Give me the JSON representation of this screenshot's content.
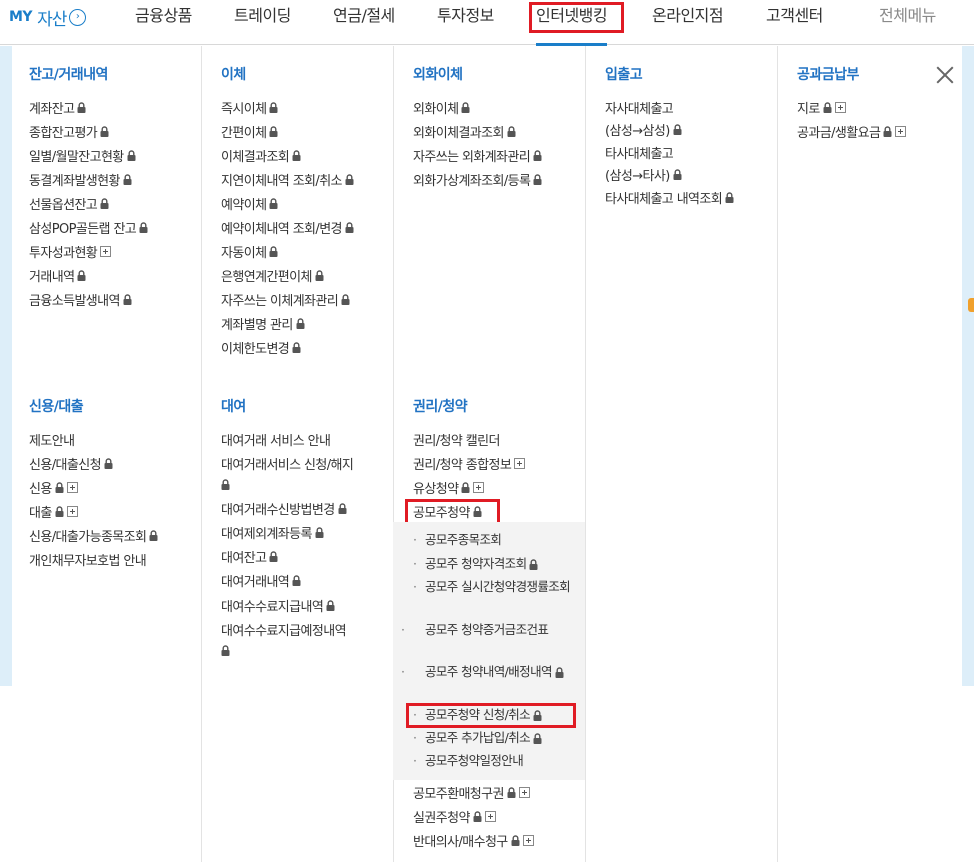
{
  "topnav": {
    "my_label": "MY",
    "asset_label": "자산",
    "items": [
      "금융상품",
      "트레이딩",
      "연금/절세",
      "투자정보",
      "인터넷뱅킹",
      "온라인지점",
      "고객센터",
      "전체메뉴"
    ]
  },
  "columns": {
    "balance": {
      "title": "잔고/거래내역",
      "items": [
        "계좌잔고",
        "종합잔고평가",
        "일별/월말잔고현황",
        "동결계좌발생현황",
        "선물옵션잔고",
        "삼성POP골든랩 잔고",
        "투자성과현황",
        "거래내역",
        "금융소득발생내역"
      ]
    },
    "transfer": {
      "title": "이체",
      "items": [
        "즉시이체",
        "간편이체",
        "이체결과조회",
        "지연이체내역 조회/취소",
        "예약이체",
        "예약이체내역 조회/변경",
        "자동이체",
        "은행연계간편이체",
        "자주쓰는 이체계좌관리",
        "계좌별명 관리",
        "이체한도변경"
      ]
    },
    "fx_transfer": {
      "title": "외화이체",
      "items": [
        "외화이체",
        "외화이체결과조회",
        "자주쓰는 외화계좌관리",
        "외화가상계좌조회/등록"
      ]
    },
    "in_out": {
      "title": "입출고",
      "items": [
        "자사대체출고",
        "(삼성→삼성)",
        "타사대체출고",
        "(삼성→타사)",
        "타사대체출고 내역조회"
      ]
    },
    "utility": {
      "title": "공과금납부",
      "items": [
        "지로",
        "공과금/생활요금"
      ]
    },
    "credit": {
      "title": "신용/대출",
      "items": [
        "제도안내",
        "신용/대출신청",
        "신용",
        "대출",
        "신용/대출가능종목조회",
        "개인채무자보호법 안내"
      ]
    },
    "lending": {
      "title": "대여",
      "items": [
        "대여거래 서비스 안내",
        "대여거래서비스 신청/해지",
        "대여거래수신방법변경",
        "대여제외계좌등록",
        "대여잔고",
        "대여거래내역",
        "대여수수료지급내역",
        "대여수수료지급예정내역"
      ]
    },
    "rights": {
      "title": "권리/청약",
      "items": [
        "권리/청약 캘린더",
        "권리/청약 종합정보",
        "유상청약",
        "공모주청약"
      ],
      "sub_items": [
        "공모주종목조회",
        "공모주 청약자격조회",
        "공모주 실시간청약경쟁률조회",
        "공모주 청약증거금조건표",
        "공모주 청약내역/배정내역",
        "공모주청약 신청/취소",
        "공모주 추가납입/취소",
        "공모주청약일정안내"
      ],
      "items_after": [
        "공모주환매청구권",
        "실권주청약",
        "반대의사/매수청구"
      ]
    }
  },
  "colors": {
    "accent": "#1a7ec9",
    "section_title": "#2273c3",
    "highlight": "#e01b24"
  }
}
